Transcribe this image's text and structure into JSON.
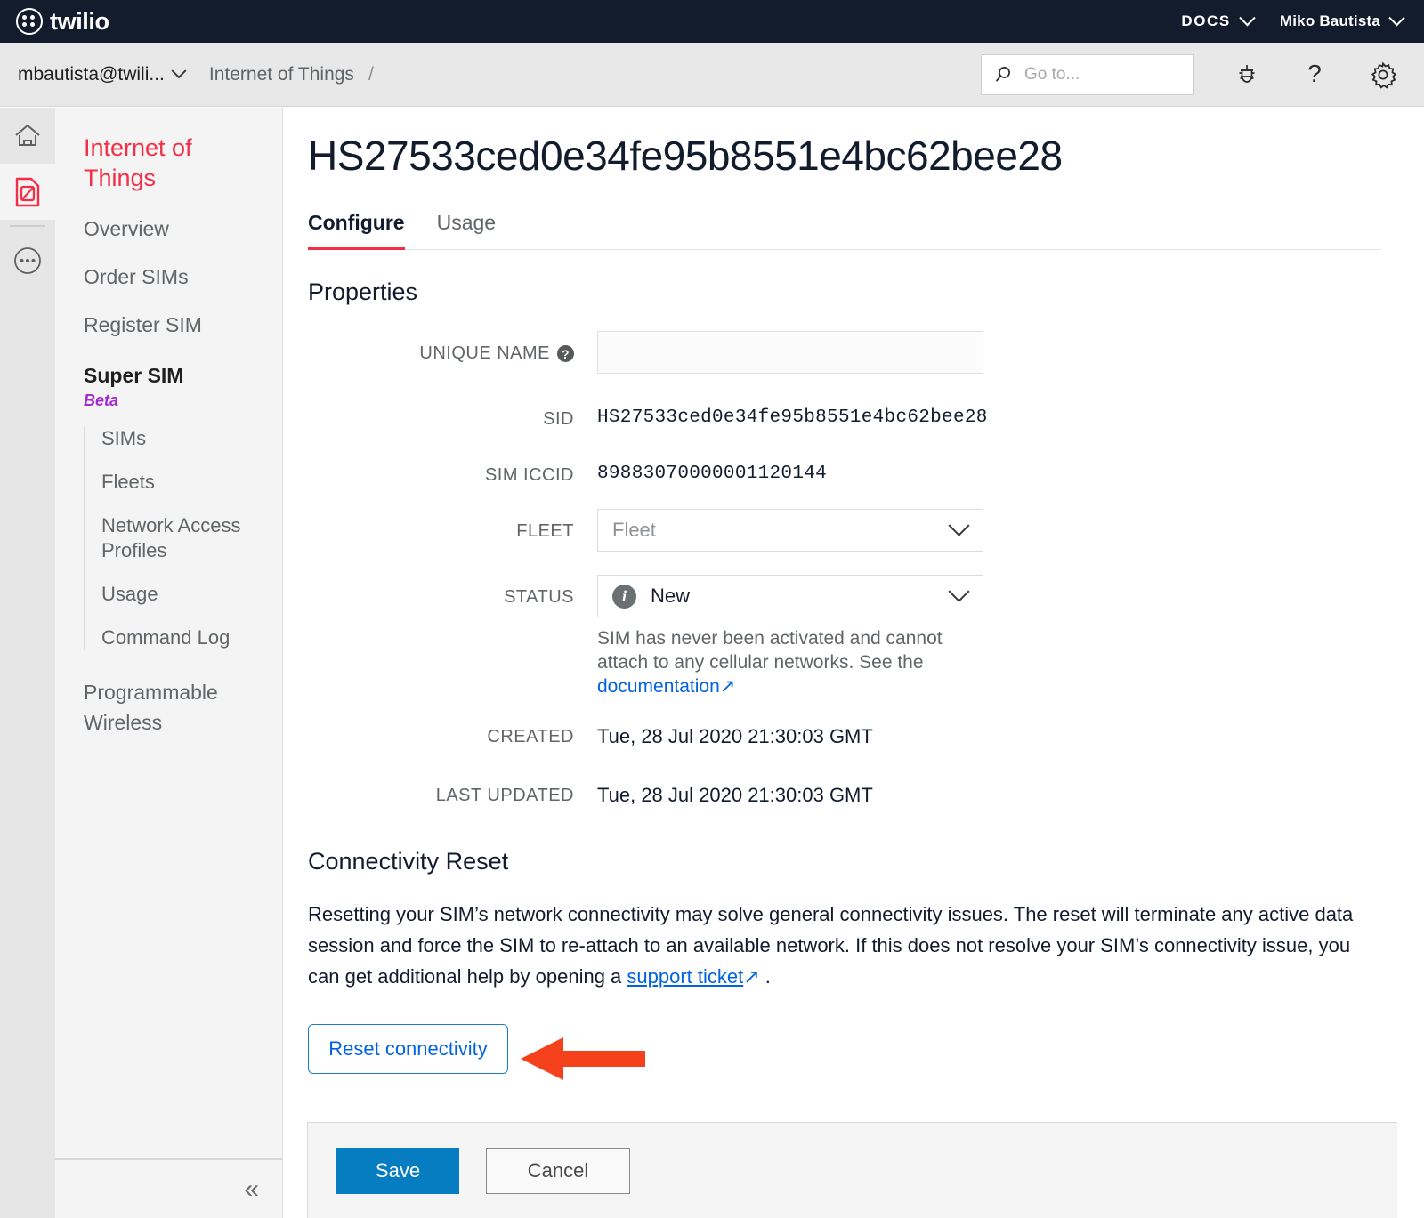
{
  "topbar": {
    "brand": "twilio",
    "docs_label": "DOCS",
    "user_label": "Miko Bautista",
    "chevron_icon": "chevron-down-icon"
  },
  "subbar": {
    "account": "mbautista@twili...",
    "breadcrumb": "Internet of Things",
    "breadcrumb_separator": "/",
    "search": {
      "placeholder": "Go to...",
      "value": "",
      "icon": "search-icon"
    },
    "icons": [
      "bug-icon",
      "question-mark-icon",
      "gear-icon"
    ]
  },
  "rail": {
    "items": [
      {
        "name": "home-icon",
        "active": false
      },
      {
        "name": "sim-card-icon",
        "active": true
      },
      {
        "name": "more-options-icon",
        "active": false
      }
    ]
  },
  "sidebar": {
    "title": "Internet of Things",
    "items": [
      {
        "label": "Overview"
      },
      {
        "label": "Order SIMs"
      },
      {
        "label": "Register SIM"
      }
    ],
    "active_section": {
      "label": "Super SIM",
      "badge": "Beta"
    },
    "sub_items": [
      {
        "label": "SIMs"
      },
      {
        "label": "Fleets"
      },
      {
        "label": "Network Access Profiles"
      },
      {
        "label": "Usage"
      },
      {
        "label": "Command Log"
      }
    ],
    "footer_item": "Programmable Wireless",
    "collapse_icon": "«"
  },
  "main": {
    "page_title": "HS27533ced0e34fe95b8551e4bc62bee28",
    "tabs": [
      {
        "label": "Configure",
        "active": true
      },
      {
        "label": "Usage",
        "active": false
      }
    ],
    "properties": {
      "heading": "Properties",
      "unique_name": {
        "label": "UNIQUE NAME",
        "help_icon": "help-circle-icon",
        "value": "",
        "placeholder": ""
      },
      "sid": {
        "label": "SID",
        "value": "HS27533ced0e34fe95b8551e4bc62bee28"
      },
      "sim_iccid": {
        "label": "SIM ICCID",
        "value": "89883070000001120144"
      },
      "fleet": {
        "label": "FLEET",
        "value": "Fleet",
        "is_placeholder": true,
        "chevron_icon": "chevron-down-icon"
      },
      "status": {
        "label": "STATUS",
        "value": "New",
        "info_icon": "info-circle-icon",
        "chevron_icon": "chevron-down-icon",
        "help_text_1": "SIM has never been activated and cannot attach to any cellular networks. See the ",
        "help_link": "documentation",
        "help_link_icon": "↗"
      },
      "created": {
        "label": "CREATED",
        "value": "Tue, 28 Jul 2020 21:30:03 GMT"
      },
      "last_updated": {
        "label": "LAST UPDATED",
        "value": "Tue, 28 Jul 2020 21:30:03 GMT"
      }
    },
    "connectivity_reset": {
      "heading": "Connectivity Reset",
      "paragraph_part1": "Resetting your SIM’s network connectivity may solve general connectivity issues. The reset will terminate any active data session and force the SIM to re-attach to an available network. If this does not resolve your SIM’s connectivity issue, you can get additional help by opening a ",
      "paragraph_link": "support ticket",
      "paragraph_link_icon": "↗",
      "paragraph_part2": " .",
      "button_label": "Reset connectivity"
    },
    "annotation": {
      "type": "arrow",
      "color": "#f4411c",
      "points_to": "reset-connectivity-button"
    }
  },
  "actionbar": {
    "save_label": "Save",
    "cancel_label": "Cancel"
  },
  "colors": {
    "brand_dark": "#121c2d",
    "brand_red": "#f22f46",
    "link_blue": "#0263e0",
    "save_blue": "#067cc1",
    "beta_purple": "#a32bcf",
    "annotation_orange": "#f4411c"
  }
}
